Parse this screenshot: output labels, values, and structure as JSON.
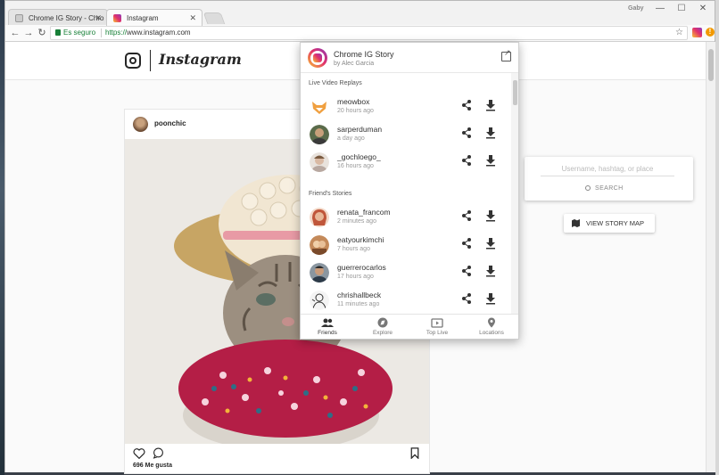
{
  "browser": {
    "tabs": [
      {
        "title": "Chrome IG Story - Chro",
        "active": false
      },
      {
        "title": "Instagram",
        "active": true
      }
    ],
    "profile_badge": "Gaby",
    "window_controls": {
      "minimize": "—",
      "maximize": "☐",
      "close": "✕"
    },
    "nav": {
      "back": "←",
      "forward": "→",
      "reload": "↻"
    },
    "security_label": "Es seguro",
    "url_protocol": "https://",
    "url_rest": "www.instagram.com",
    "star": "☆",
    "warn_badge": "!"
  },
  "instagram": {
    "wordmark": "Instagram",
    "post": {
      "username": "poonchic",
      "likes": "696 Me gusta",
      "icons": [
        "heart-icon",
        "comment-icon",
        "bookmark-icon"
      ]
    },
    "search": {
      "placeholder": "Username, hashtag, or place",
      "button_label": "SEARCH"
    },
    "map_button_label": "VIEW STORY MAP"
  },
  "popup": {
    "title": "Chrome IG Story",
    "subtitle": "by Alec Garcia",
    "sections": [
      {
        "heading": "Live Video Replays",
        "items": [
          {
            "name": "meowbox",
            "time": "20 hours ago",
            "avatar_color": "#f0a040"
          },
          {
            "name": "sarperduman",
            "time": "a day ago",
            "avatar_color": "#5a6b4a"
          },
          {
            "name": "_gochloego_",
            "time": "16 hours ago",
            "avatar_color": "#d9c7b8"
          }
        ]
      },
      {
        "heading": "Friend's Stories",
        "items": [
          {
            "name": "renata_francom",
            "time": "2 minutes ago",
            "avatar_color": "#c0563a"
          },
          {
            "name": "eatyourkimchi",
            "time": "7 hours ago",
            "avatar_color": "#c48a5a"
          },
          {
            "name": "guerrerocarlos",
            "time": "17 hours ago",
            "avatar_color": "#4a5560"
          },
          {
            "name": "chrishallbeck",
            "time": "11 minutes ago",
            "avatar_color": "#e8e8e8"
          }
        ]
      }
    ],
    "tabs": [
      {
        "label": "Friends",
        "icon": "people-icon",
        "active": true
      },
      {
        "label": "Explore",
        "icon": "compass-icon",
        "active": false
      },
      {
        "label": "Top Live",
        "icon": "live-tv-icon",
        "active": false
      },
      {
        "label": "Locations",
        "icon": "location-pin-icon",
        "active": false
      }
    ]
  }
}
